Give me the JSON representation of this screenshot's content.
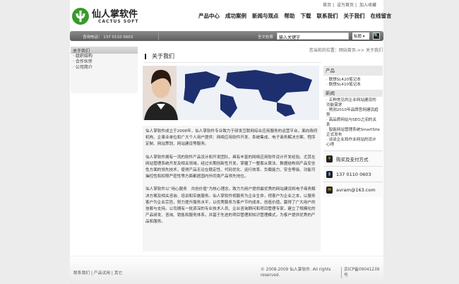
{
  "top_links": [
    "首页",
    "设为首页",
    "加入收藏"
  ],
  "logo": {
    "cn": "仙人掌软件",
    "en": "CACTUS SOFT"
  },
  "nav": [
    "产品中心",
    "成功案例",
    "新闻与观点",
    "帮助",
    "下载",
    "联系我们",
    "关于我们",
    "在线留言"
  ],
  "bar": {
    "phone": "咨询电话： 137 0110 0603",
    "search_label": "全文检索",
    "search_value": "输入关键字",
    "select": "标题",
    "go": "🔍"
  },
  "sidebar": {
    "title": "关于我们",
    "items": [
      "组织结构",
      "合作伙伴",
      "公司简介"
    ]
  },
  "breadcrumb": "您当前的位置：网站首页->> 关于我们",
  "page_title": "关于我们",
  "paragraphs": [
    "仙人掌软件成立于2008年，仙人掌软件专业致力于研发互联网综合应用服务的运营平台，面向政府机构、企事业单位和广大个人用户提供：网络应用软件开发、系统集成、电子商务解决方案、程序定制、网站策划、网站建设等服务。",
    "仙人掌软件拥有一流的软件产品设计和开发团队，具有丰富的网络应用软件设计开发经验。尤其在网站管理系统开发及相关领域，经过长期创新性开发，掌握了一整套从算法、数据结构到产品安全性方面的领先技术，使得产品无论在稳定性、代码优化、运行效率、负载能力、安全等级、功能可操控性和权限严密性等方面都居国内外同类产品领先地位。",
    "仙人掌软件以“用心服务　共创价值”为核心理念，致力为用户提供最优秀的网站建设和电子商务解决方案及相关咨询、培训和实施服务。仙人掌软件视服务为企业生命，视客户为企业之本，以服务客户为企业宗旨，努力提升服务水平，以优秀服务为客户节约成本，创造价值，赢得了广大用户的信赖与支持。公司拥有一批资深的专业技术人员、企业咨询顾问和项目管理专家，建立了规模化的产品研发、咨询、销售和服务体系，并基于先进的项目管理和知识管理模式，为客户提供优秀的产品和服务。"
  ],
  "right": {
    "products_title": "产品",
    "products": [
      "联想SL420笔记本",
      "联想SL410笔记本"
    ],
    "news_title": "新闻",
    "news": [
      "五种常见的企业网站建设的功能需求",
      "预测2010年品牌官网建设趋势",
      "高品质网站与SEO之间的关系",
      "智能网站管理系统SmartSite正式发布",
      "谈谈企业和作业网站的设计心得"
    ],
    "buy": "购买及支付方式",
    "phone": "137 0110 0603",
    "email": "avram@163.com"
  },
  "footer": {
    "links": [
      "联系我们",
      "产品试用",
      "其它"
    ],
    "copyright": "© 2008-2009 仙人掌软件. All rights reserved.",
    "icp": "京ICP备09041239号"
  }
}
